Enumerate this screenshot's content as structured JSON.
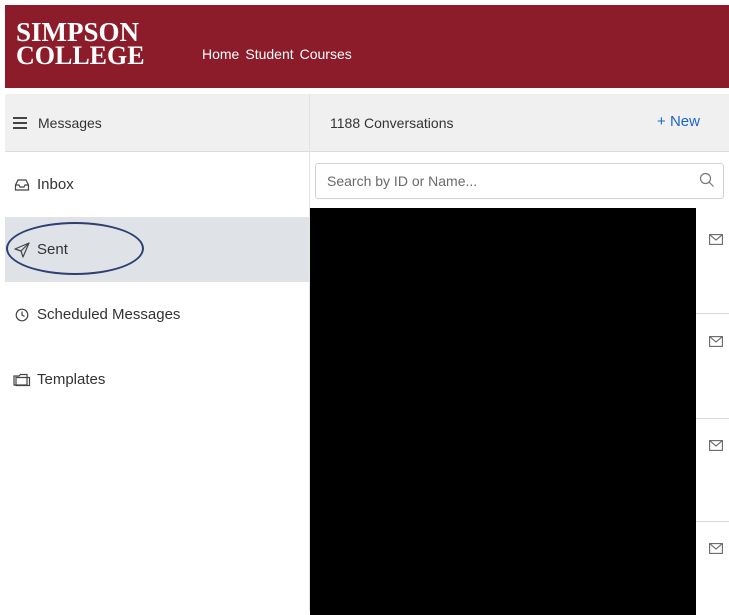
{
  "header": {
    "logo_line1": "SIMPSON",
    "logo_line2": "COLLEGE",
    "brand_color": "#8d1c2a",
    "nav": [
      "Home",
      "Student",
      "Courses"
    ]
  },
  "sidebar": {
    "title": "Messages",
    "items": [
      {
        "label": "Inbox",
        "icon": "inbox-icon"
      },
      {
        "label": "Sent",
        "icon": "send-icon",
        "active": true
      },
      {
        "label": "Scheduled Messages",
        "icon": "clock-icon"
      },
      {
        "label": "Templates",
        "icon": "folder-icon"
      }
    ]
  },
  "conversations": {
    "count_label": "1188 Conversations",
    "new_label": "New",
    "search_placeholder": "Search by ID or Name...",
    "rows": [
      {
        "icon": "envelope-icon"
      },
      {
        "icon": "envelope-icon"
      },
      {
        "icon": "envelope-icon"
      },
      {
        "icon": "envelope-icon"
      }
    ],
    "accent_color": "#1a66c9"
  }
}
